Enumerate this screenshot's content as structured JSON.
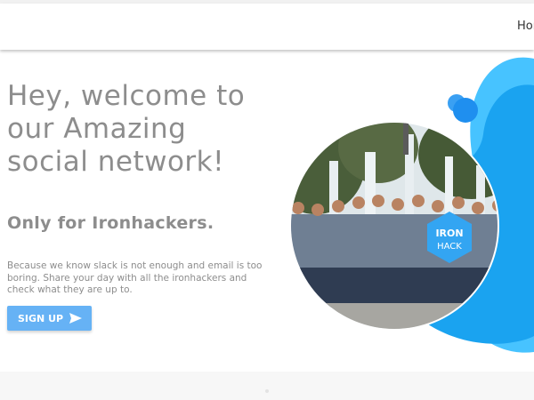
{
  "nav": {
    "home_label": "Home"
  },
  "hero": {
    "headline": "Hey, welcome to our Amazing social network!",
    "subheadline": "Only for Ironhackers.",
    "description": "Because we know slack is not enough and email is too boring. Share your day with all the ironhackers and check what they are up to.",
    "signup_label": "SIGN UP",
    "badge_line1": "IRON",
    "badge_line2": "HACK"
  },
  "colors": {
    "accent_blue": "#66b2f5",
    "bubble_blue": "#1aa3f0",
    "bubble_light": "#47c3ff",
    "text_gray": "#8d8d8d"
  },
  "icons": {
    "signup_arrow": "send-arrow-icon"
  }
}
